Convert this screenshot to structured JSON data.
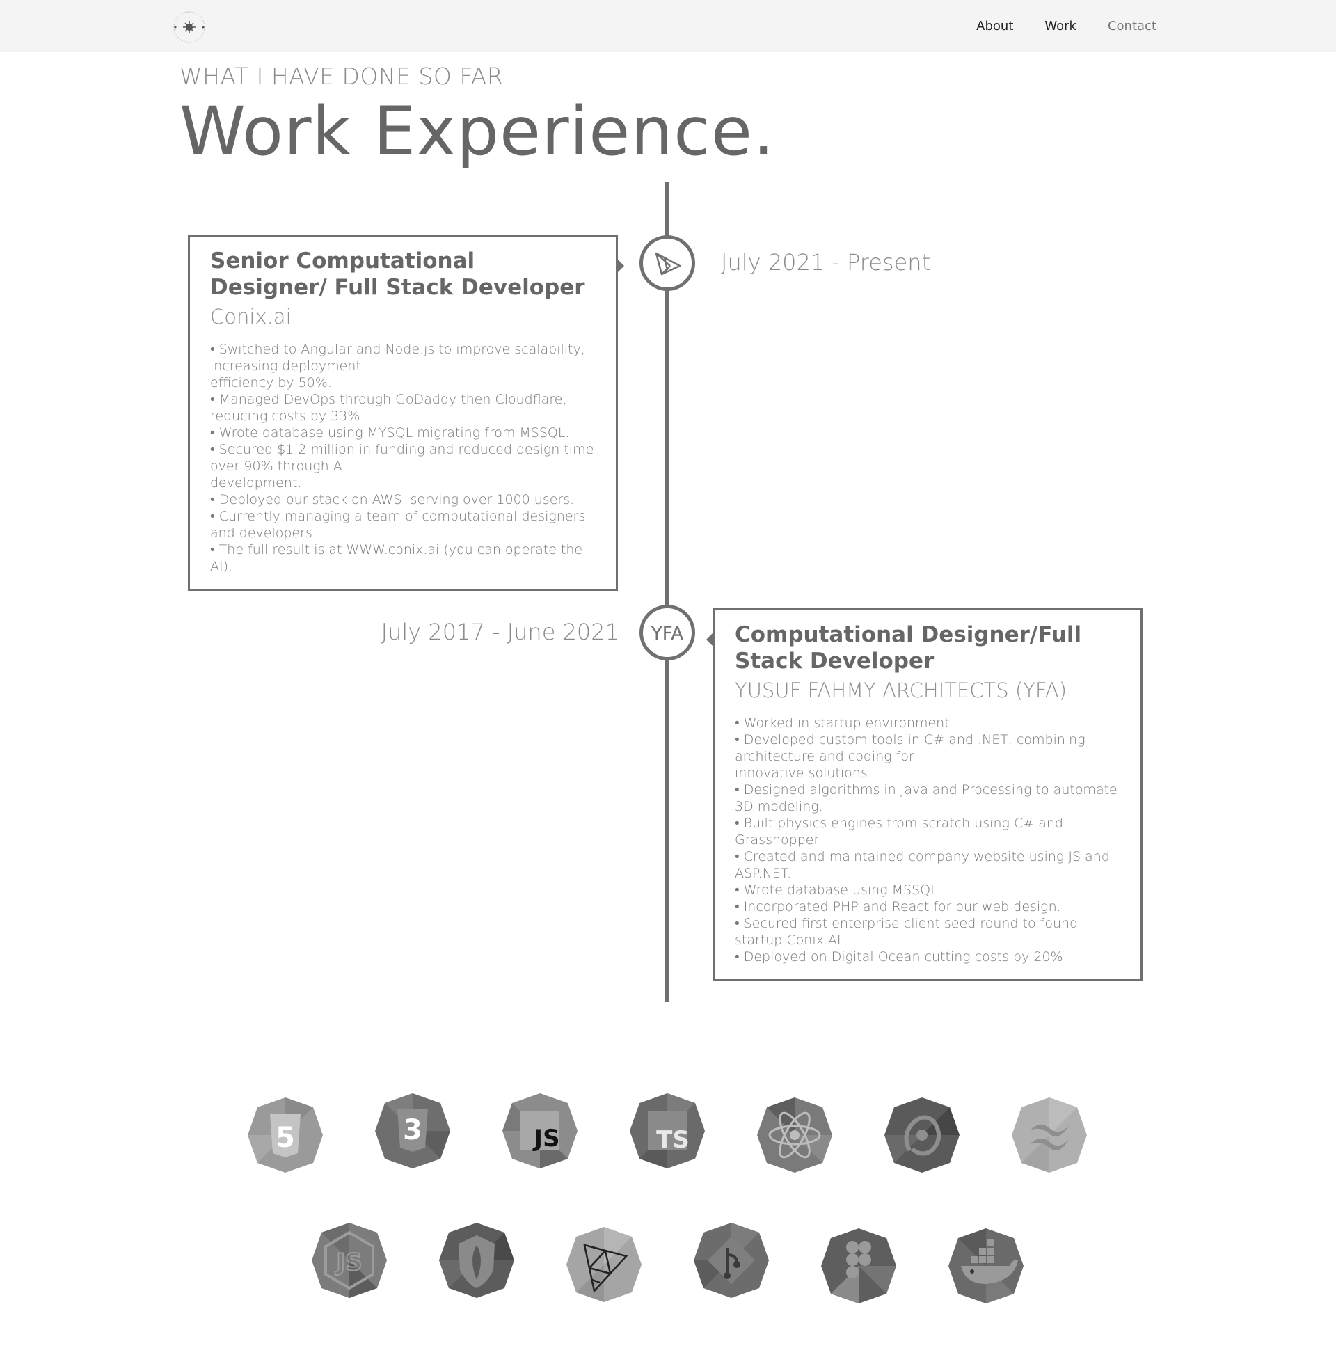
{
  "nav": {
    "links": [
      "About",
      "Work",
      "Contact"
    ]
  },
  "header": {
    "eyebrow": "WHAT I HAVE DONE SO FAR",
    "title": "Work Experience."
  },
  "experiences": [
    {
      "title": "Senior Computational Designer/ Full Stack Developer",
      "company": "Conix.ai",
      "date": "July 2021 - Present",
      "icon": "conix-logo-icon",
      "points": [
        "• Switched to Angular and Node.js to improve scalability, increasing deployment",
        "efficiency by 50%.",
        "• Managed DevOps through GoDaddy then Cloudflare, reducing costs by 33%.",
        "• Wrote database using MYSQL migrating from MSSQL.",
        "• Secured $1.2 million in funding and reduced design time over 90% through AI",
        "development.",
        "• Deployed our stack on AWS, serving over 1000 users.",
        "• Currently managing a team of computational designers and developers.",
        "• The full result is at WWW.conix.ai (you can operate the AI)."
      ]
    },
    {
      "title": "Computational Designer/Full Stack Developer",
      "company": "YUSUF FAHMY ARCHITECTS (YFA)",
      "date": "July 2017 - June 2021",
      "icon": "yfa-logo-icon",
      "icon_text": "YFA",
      "points": [
        "• Worked in startup environment",
        "• Developed custom tools in C# and .NET, combining architecture and coding for",
        "innovative solutions.",
        "• Designed algorithms in Java and Processing to automate 3D modeling.",
        "• Built physics engines from scratch using C# and Grasshopper.",
        "• Created and maintained company website using JS and ASP.NET.",
        "• Wrote database using MSSQL",
        "• Incorporated PHP and React for our web design.",
        "• Secured first enterprise client seed round to found startup Conix.AI",
        "• Deployed on Digital Ocean cutting costs by 20%"
      ]
    }
  ],
  "tech": {
    "row1": [
      {
        "name": "html5",
        "label": "5",
        "shade": "#9a9a9a"
      },
      {
        "name": "css3",
        "label": "3",
        "shade": "#6e6e6e"
      },
      {
        "name": "javascript",
        "label": "JS",
        "shade": "#8c8c8c"
      },
      {
        "name": "typescript",
        "label": "TS",
        "shade": "#6a6a6a"
      },
      {
        "name": "react",
        "label": "",
        "shade": "#7a7a7a"
      },
      {
        "name": "redux",
        "label": "",
        "shade": "#5a5a5a"
      },
      {
        "name": "tailwind",
        "label": "",
        "shade": "#b0b0b0"
      }
    ],
    "row2": [
      {
        "name": "nodejs",
        "label": "JS",
        "shade": "#7c7c7c"
      },
      {
        "name": "mongodb",
        "label": "",
        "shade": "#5c5c5c"
      },
      {
        "name": "threejs",
        "label": "",
        "shade": "#a5a5a5"
      },
      {
        "name": "git",
        "label": "",
        "shade": "#6c6c6c"
      },
      {
        "name": "figma",
        "label": "",
        "shade": "#5e5e5e"
      },
      {
        "name": "docker",
        "label": "",
        "shade": "#6a6a6a"
      }
    ]
  }
}
